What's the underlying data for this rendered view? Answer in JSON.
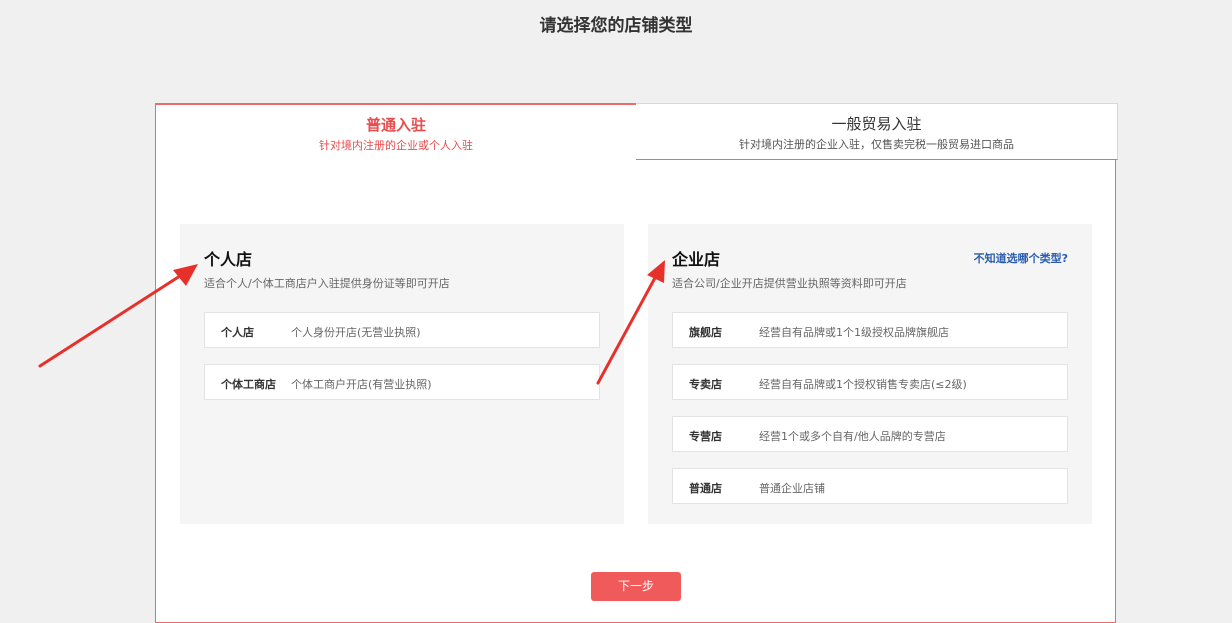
{
  "page": {
    "title": "请选择您的店铺类型"
  },
  "tabs": [
    {
      "title": "普通入驻",
      "subtitle": "针对境内注册的企业或个人入驻"
    },
    {
      "title": "一般贸易入驻",
      "subtitle": "针对境内注册的企业入驻，仅售卖完税一般贸易进口商品"
    }
  ],
  "personal": {
    "title": "个人店",
    "desc": "适合个人/个体工商店户入驻提供身份证等即可开店",
    "options": [
      {
        "name": "个人店",
        "desc": "个人身份开店(无营业执照)"
      },
      {
        "name": "个体工商店",
        "desc": "个体工商户开店(有营业执照)"
      }
    ]
  },
  "enterprise": {
    "title": "企业店",
    "desc": "适合公司/企业开店提供营业执照等资料即可开店",
    "help_link": "不知道选哪个类型?",
    "options": [
      {
        "name": "旗舰店",
        "desc": "经营自有品牌或1个1级授权品牌旗舰店"
      },
      {
        "name": "专卖店",
        "desc": "经营自有品牌或1个授权销售专卖店(≤2级)"
      },
      {
        "name": "专营店",
        "desc": "经营1个或多个自有/他人品牌的专营店"
      },
      {
        "name": "普通店",
        "desc": "普通企业店铺"
      }
    ]
  },
  "next_button": "下一步",
  "colors": {
    "accent": "#e84c4c",
    "link": "#2a5db0",
    "arrow": "#e8302a"
  },
  "icons": [
    "annotation-arrow-icon"
  ]
}
